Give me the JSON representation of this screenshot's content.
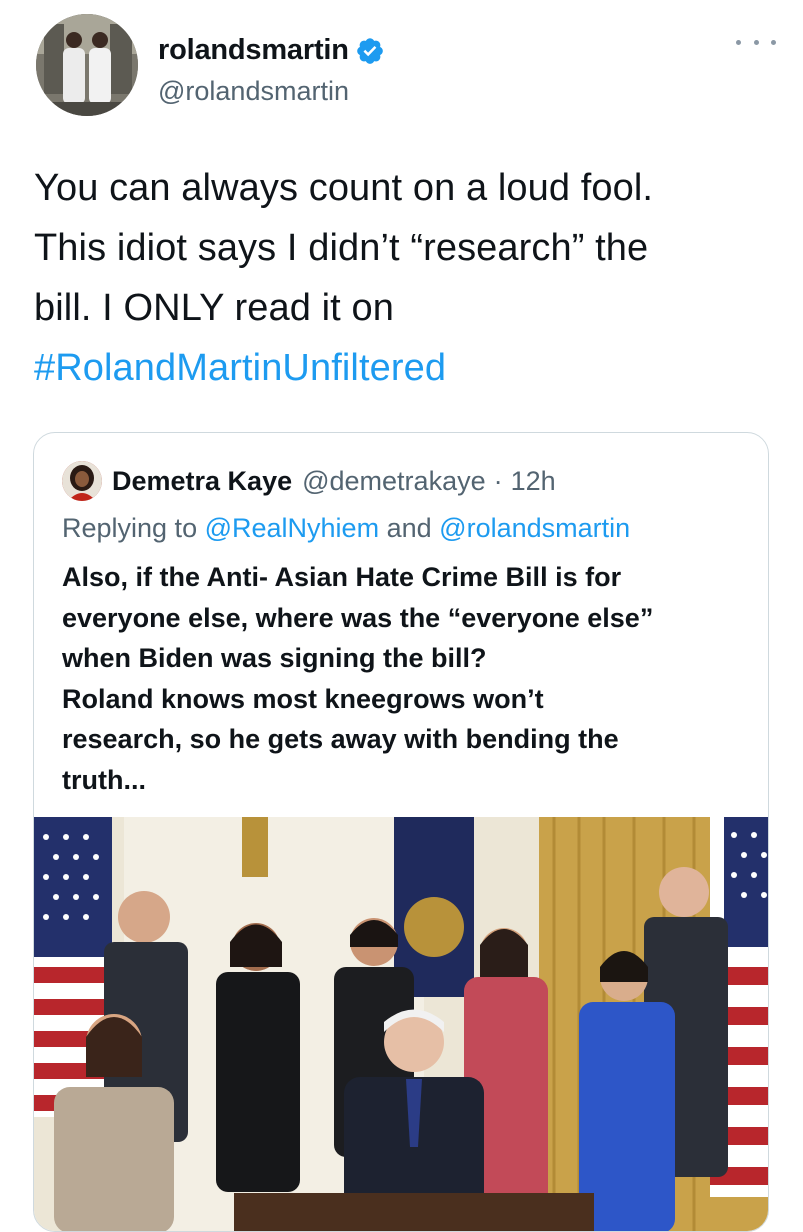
{
  "tweet": {
    "author_name": "rolandsmartin",
    "author_handle": "@rolandsmartin",
    "text_lines": [
      "You can always count on a loud fool.",
      "This idiot says I didn’t “research” the",
      "bill. I ONLY read it on"
    ],
    "hashtag": "#RolandMartinUnfiltered",
    "verified_icon": "verified-badge-icon",
    "more_icon": "more-options-icon"
  },
  "quoted_tweet": {
    "author_name": "Demetra Kaye",
    "author_handle": "@demetrakaye",
    "separator": "·",
    "time": "12h",
    "replying_prefix": "Replying to",
    "replying_user1": "@RealNyhiem",
    "replying_and": "and",
    "replying_user2": "@rolandsmartin",
    "text_lines": [
      "Also, if the Anti- Asian Hate Crime Bill is for",
      "everyone else, where was the “everyone else”",
      "when Biden was signing the bill?",
      "Roland knows most kneegrows won’t",
      "research, so he gets away with bending the",
      "truth..."
    ]
  },
  "colors": {
    "link": "#1d9bf0",
    "text": "#0f1419",
    "secondary": "#536471",
    "border": "#cfd9de",
    "verified": "#1d9bf0"
  }
}
